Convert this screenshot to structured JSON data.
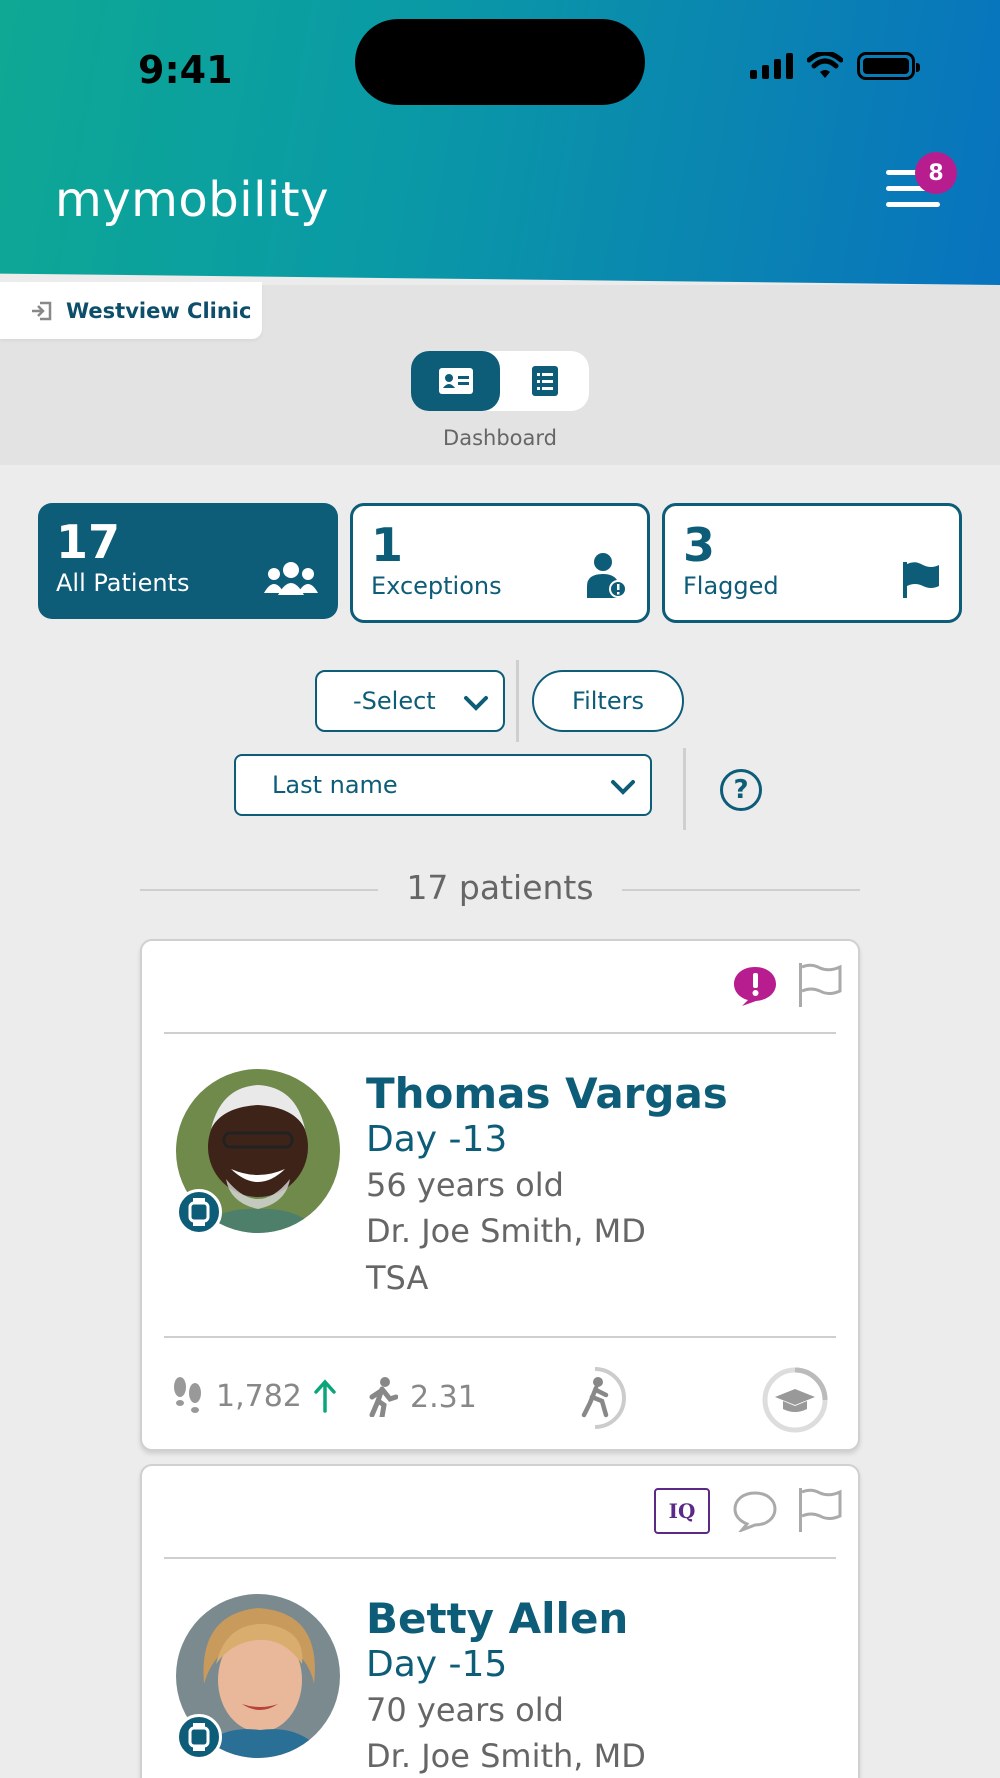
{
  "status_bar": {
    "time": "9:41"
  },
  "header": {
    "logo": "mymobility",
    "notification_count": "8"
  },
  "clinic": {
    "name": "Westview Clinic"
  },
  "view_toggle": {
    "label": "Dashboard",
    "active": "card-view"
  },
  "summary": [
    {
      "count": "17",
      "label": "All Patients",
      "icon": "users-icon"
    },
    {
      "count": "1",
      "label": "Exceptions",
      "icon": "user-alert-icon"
    },
    {
      "count": "3",
      "label": "Flagged",
      "icon": "flag-icon"
    }
  ],
  "filters": {
    "select_value": "-Select",
    "filters_label": "Filters",
    "sort_value": "Last name",
    "help_label": "?"
  },
  "patient_count": "17 patients",
  "patients": [
    {
      "name": "Thomas Vargas",
      "day": "Day -13",
      "age": "56 years old",
      "doctor": "Dr. Joe Smith, MD",
      "procedure": "TSA",
      "steps": "1,782",
      "walking_speed": "2.31",
      "status_icons": [
        "message-alert-icon",
        "flag-outline-icon"
      ]
    },
    {
      "name": "Betty Allen",
      "day": "Day -15",
      "age": "70 years old",
      "doctor": "Dr. Joe Smith, MD",
      "iq_label": "IQ",
      "status_icons": [
        "iq-icon",
        "chat-icon",
        "flag-outline-icon"
      ]
    }
  ],
  "colors": {
    "primary": "#0d5c78",
    "accent": "#b81d8f",
    "trend_up": "#0aa57a"
  }
}
